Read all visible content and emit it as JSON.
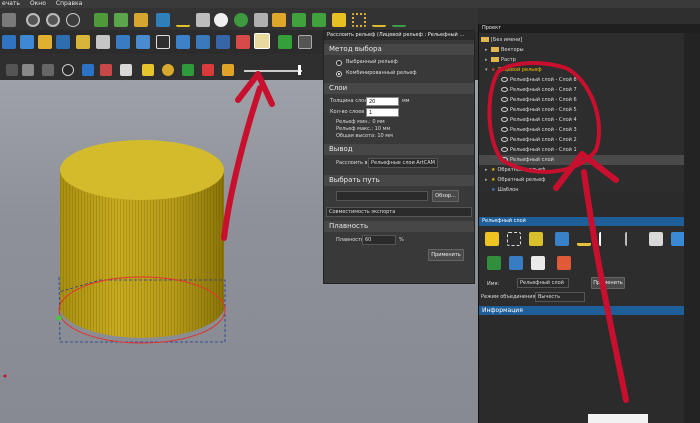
{
  "menu": {
    "print": "ечать",
    "window": "Окно",
    "help": "Справка"
  },
  "dialog": {
    "title": "Расслоить рельеф (Лицевой рельеф : Рельефный ...",
    "method": {
      "heading": "Метод выбора",
      "selected_relief": "Выбранный рельеф",
      "combined_relief": "Комбинированный рельеф"
    },
    "layers": {
      "heading": "Слои",
      "thickness_label": "Толщина слоя",
      "thickness_value": "20",
      "thickness_unit": "мм",
      "count_label": "Кол-во слоев",
      "count_value": "1",
      "relief_min": "Рельеф мин.: 0 мм",
      "relief_max": "Рельеф макс.: 10 мм",
      "total_height": "Общая высота: 10 мм"
    },
    "output": {
      "heading": "Вывод",
      "split_label": "Расслоить в:",
      "split_value": "Рельефные слои ArtCAM"
    },
    "path": {
      "heading": "Выбрать путь",
      "browse": "Обзор..."
    },
    "compat": "Совместимость экспорта",
    "smooth": {
      "heading": "Плавность",
      "label": "Плавность",
      "value": "60",
      "unit": "%"
    },
    "apply": "Применить"
  },
  "project": {
    "header": "Проект",
    "items": [
      {
        "label": "[Без имени]"
      },
      {
        "label": "Векторы"
      },
      {
        "label": "Растр"
      },
      {
        "label": "Лицевой рельеф"
      },
      {
        "label": "Рельефный слой - Слой 8"
      },
      {
        "label": "Рельефный слой - Слой 7"
      },
      {
        "label": "Рельефный слой - Слой 6"
      },
      {
        "label": "Рельефный слой - Слой 5"
      },
      {
        "label": "Рельефный слой - Слой 4"
      },
      {
        "label": "Рельефный слой - Слой 3"
      },
      {
        "label": "Рельефный слой - Слой 2"
      },
      {
        "label": "Рельефный слой - Слой 1"
      },
      {
        "label": "Рельефный слой"
      },
      {
        "label": "Обратный рельеф"
      },
      {
        "label": "Обратный рельеф"
      },
      {
        "label": "Шаблон"
      }
    ]
  },
  "relief_layer": {
    "header": "Рельефный слой",
    "name_label": "Имя:",
    "name_value": "Рельефный слой",
    "apply": "Применить",
    "mode_label": "Режим объединения:",
    "mode_value": "Вычесть"
  },
  "info": {
    "header": "Информация"
  },
  "colors": {
    "accent_blue": "#1e5f9a",
    "relief_gold": "#c9ad2a",
    "annotation_red": "#c8102e",
    "selection_red": "#e2322f"
  }
}
